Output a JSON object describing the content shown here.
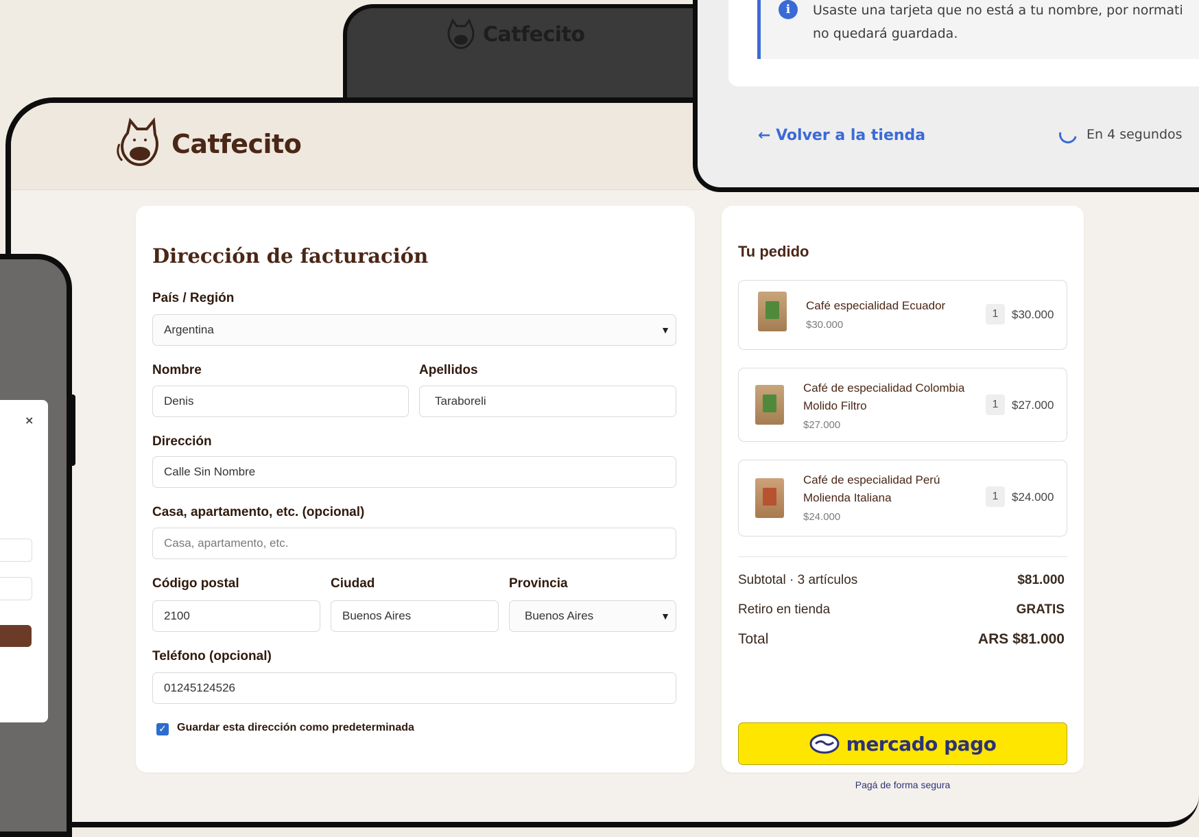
{
  "back_window": {
    "logo_text": "Catfecito"
  },
  "header": {
    "logo_text": "Catfecito"
  },
  "billing": {
    "title": "Dirección de facturación",
    "country_label": "País / Región",
    "country_value": "Argentina",
    "first_name_label": "Nombre",
    "first_name_value": "Denis",
    "last_name_label": "Apellidos",
    "last_name_value": "Taraboreli",
    "address_label": "Dirección",
    "address_value": "Calle Sin Nombre",
    "apt_label": "Casa, apartamento, etc. (opcional)",
    "apt_placeholder": "Casa, apartamento, etc.",
    "postal_label": "Código postal",
    "postal_value": "2100",
    "city_label": "Ciudad",
    "city_value": "Buenos Aires",
    "province_label": "Provincia",
    "province_value": "Buenos Aires",
    "phone_label": "Teléfono (opcional)",
    "phone_value": "01245124526",
    "save_default_label": "Guardar esta dirección como predeterminada",
    "save_default_checked": true
  },
  "order": {
    "title": "Tu pedido",
    "items": [
      {
        "name": "Café especialidad Ecuador",
        "price": "$30.000",
        "qty": "1",
        "total": "$30.000"
      },
      {
        "name_line1": "Café de especialidad Colombia",
        "name_line2": "Molido Filtro",
        "price": "$27.000",
        "qty": "1",
        "total": "$27.000"
      },
      {
        "name_line1": "Café de especialidad Perú",
        "name_line2": "Molienda Italiana",
        "price": "$24.000",
        "qty": "1",
        "total": "$24.000"
      }
    ],
    "subtotal_label": "Subtotal · 3 artículos",
    "subtotal_value": "$81.000",
    "shipping_label": "Retiro en tienda",
    "shipping_value": "GRATIS",
    "total_label": "Total",
    "total_value": "ARS $81.000",
    "pay_button_text": "mercado pago",
    "secure_text": "Pagá de forma segura"
  },
  "confirmation": {
    "notice_line1": "Usaste una tarjeta que no está a tu nombre, por normati",
    "notice_line2": "no quedará guardada.",
    "back_link": "← Volver a la tienda",
    "countdown": "En 4 segundos"
  },
  "phone": {
    "close_glyph": "×"
  },
  "colors": {
    "brand_brown": "#4a2716",
    "accent_blue": "#3a6ad6",
    "mp_yellow": "#ffe600",
    "mp_navy": "#2d3277"
  }
}
